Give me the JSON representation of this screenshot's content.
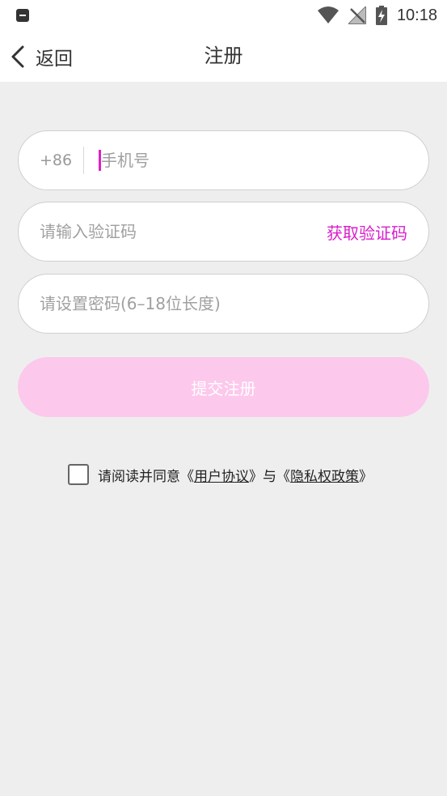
{
  "status_bar": {
    "time": "10:18",
    "icons": [
      "app-notification-icon",
      "wifi-icon",
      "no-signal-icon",
      "battery-charging-icon"
    ]
  },
  "nav": {
    "back_label": "返回",
    "title": "注册"
  },
  "form": {
    "country_code": "+86",
    "phone_placeholder": "手机号",
    "code_placeholder": "请输入验证码",
    "get_code_label": "获取验证码",
    "password_placeholder": "请设置密码(6–18位长度)",
    "submit_label": "提交注册"
  },
  "agreement": {
    "prefix": "请阅读并同意《",
    "user_agreement": "用户协议",
    "middle": "》与《",
    "privacy_policy": "隐私权政策",
    "suffix": "》",
    "checked": false
  },
  "colors": {
    "accent": "#d81ecb",
    "submit_bg": "#fcc8ec",
    "background": "#eeeeee"
  }
}
